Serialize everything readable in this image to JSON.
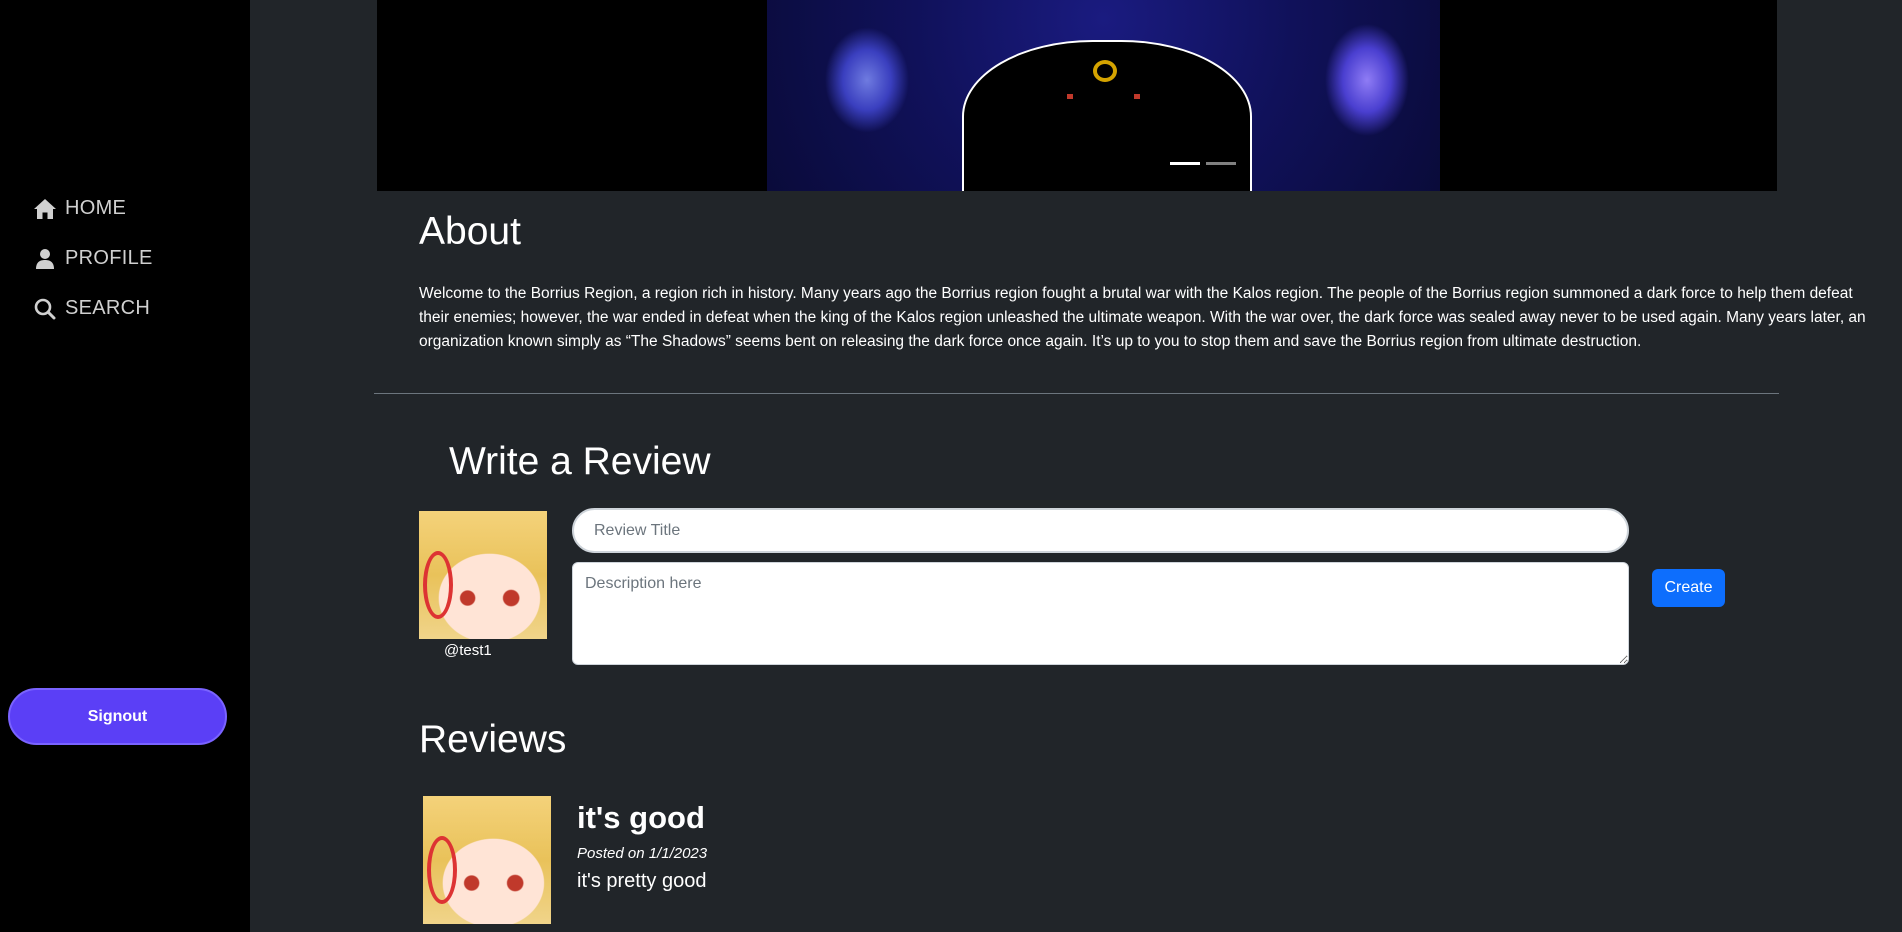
{
  "sidebar": {
    "items": [
      {
        "label": "HOME",
        "icon": "home-icon"
      },
      {
        "label": "PROFILE",
        "icon": "person-icon"
      },
      {
        "label": "SEARCH",
        "icon": "search-icon"
      }
    ],
    "signout_label": "Signout"
  },
  "about": {
    "title": "About",
    "lines": [
      "Welcome to the Borrius Region, a region rich in history. Many years ago the Borrius region fought a brutal war with the Kalos region. The people of the Borrius region summoned a dark force to help them defeat",
      "their enemies; however, the war ended in defeat when the king of the Kalos region unleashed the ultimate weapon. With the war over, the dark force was sealed away never to be used again. Many years later, an",
      "organization known simply as “The Shadows” seems bent on releasing the dark force once again. It’s up to you to stop them and save the Borrius region from ultimate destruction."
    ]
  },
  "write_review": {
    "title": "Write a Review",
    "username": "@test1",
    "title_placeholder": "Review Title",
    "description_placeholder": "Description here",
    "create_label": "Create"
  },
  "reviews": {
    "title": "Reviews",
    "items": [
      {
        "title": "it's good",
        "posted_prefix": "Posted on ",
        "date": "1/1/2023",
        "body": "it's pretty good"
      }
    ]
  },
  "colors": {
    "sidebar_bg": "#000000",
    "main_bg": "#212529",
    "signout_bg": "#5b3ff6",
    "create_bg": "#0d6efd"
  }
}
